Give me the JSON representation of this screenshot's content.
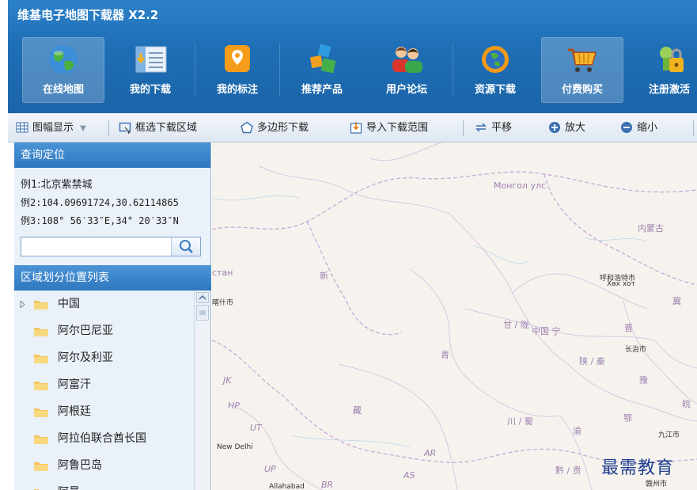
{
  "app": {
    "title": "维基电子地图下载器 X2.2"
  },
  "ribbon": [
    {
      "label": "在线地图",
      "icon": "globe-icon"
    },
    {
      "label": "我的下载",
      "icon": "download-list-icon"
    },
    {
      "label": "我的标注",
      "icon": "map-pin-icon"
    },
    {
      "label": "推荐产品",
      "icon": "cubes-icon"
    },
    {
      "label": "用户论坛",
      "icon": "users-icon"
    },
    {
      "label": "资源下载",
      "icon": "resource-download-icon"
    },
    {
      "label": "付费购买",
      "icon": "shopping-cart-icon"
    },
    {
      "label": "注册激活",
      "icon": "key-lock-icon"
    }
  ],
  "toolbar": {
    "display_mode": "图幅显示",
    "select_area": "框选下载区域",
    "polygon": "多边形下载",
    "import_range": "导入下载范围",
    "pan": "平移",
    "zoom_in": "放大",
    "zoom_out": "缩小"
  },
  "search": {
    "header": "查询定位",
    "example1": "例1:北京紫禁城",
    "example2": "例2:104.09691724,30.62114865",
    "example3": "例3:108° 56′33″E,34° 20′33″N",
    "value": ""
  },
  "regions": {
    "header": "区域划分位置列表",
    "items": [
      "中国",
      "阿尔巴尼亚",
      "阿尔及利亚",
      "阿富汗",
      "阿根廷",
      "阿拉伯联合酋长国",
      "阿鲁巴岛",
      "阿曼"
    ]
  },
  "map": {
    "labels": {
      "mongolia": "Монгол улс",
      "inner_mongolia": "内蒙古",
      "xinjiang": "新",
      "kazakh_fragment": "стан",
      "hohhot": "呼和浩特市",
      "hohhot_mn": "Хөх хот",
      "kashgar_fragment": "喀什市",
      "gansu": "甘 / 陇",
      "china": "中国 宁",
      "jin": "晋",
      "changzhi": "长治市",
      "shaanxi": "陕 / 秦",
      "qinghai": "青",
      "henan": "豫",
      "ji": "冀",
      "tibet": "藏",
      "jk": "JK",
      "hp": "HP",
      "ut": "UT",
      "up": "UP",
      "ar": "AR",
      "as": "AS",
      "br": "BR",
      "new_delhi": "New Delhi",
      "allahabad": "Allahabad",
      "sichuan": "川 / 蜀",
      "yu": "渝",
      "e": "鄂",
      "wan": "皖",
      "jiujiang": "九江市",
      "guizhou": "黔 / 贵",
      "ganzhou": "赣州市"
    }
  },
  "watermark": "最需教育",
  "colors": {
    "title_bar": "#1f6fb6",
    "panel_header": "#3b86cc",
    "map_background": "#f6f3ee"
  }
}
